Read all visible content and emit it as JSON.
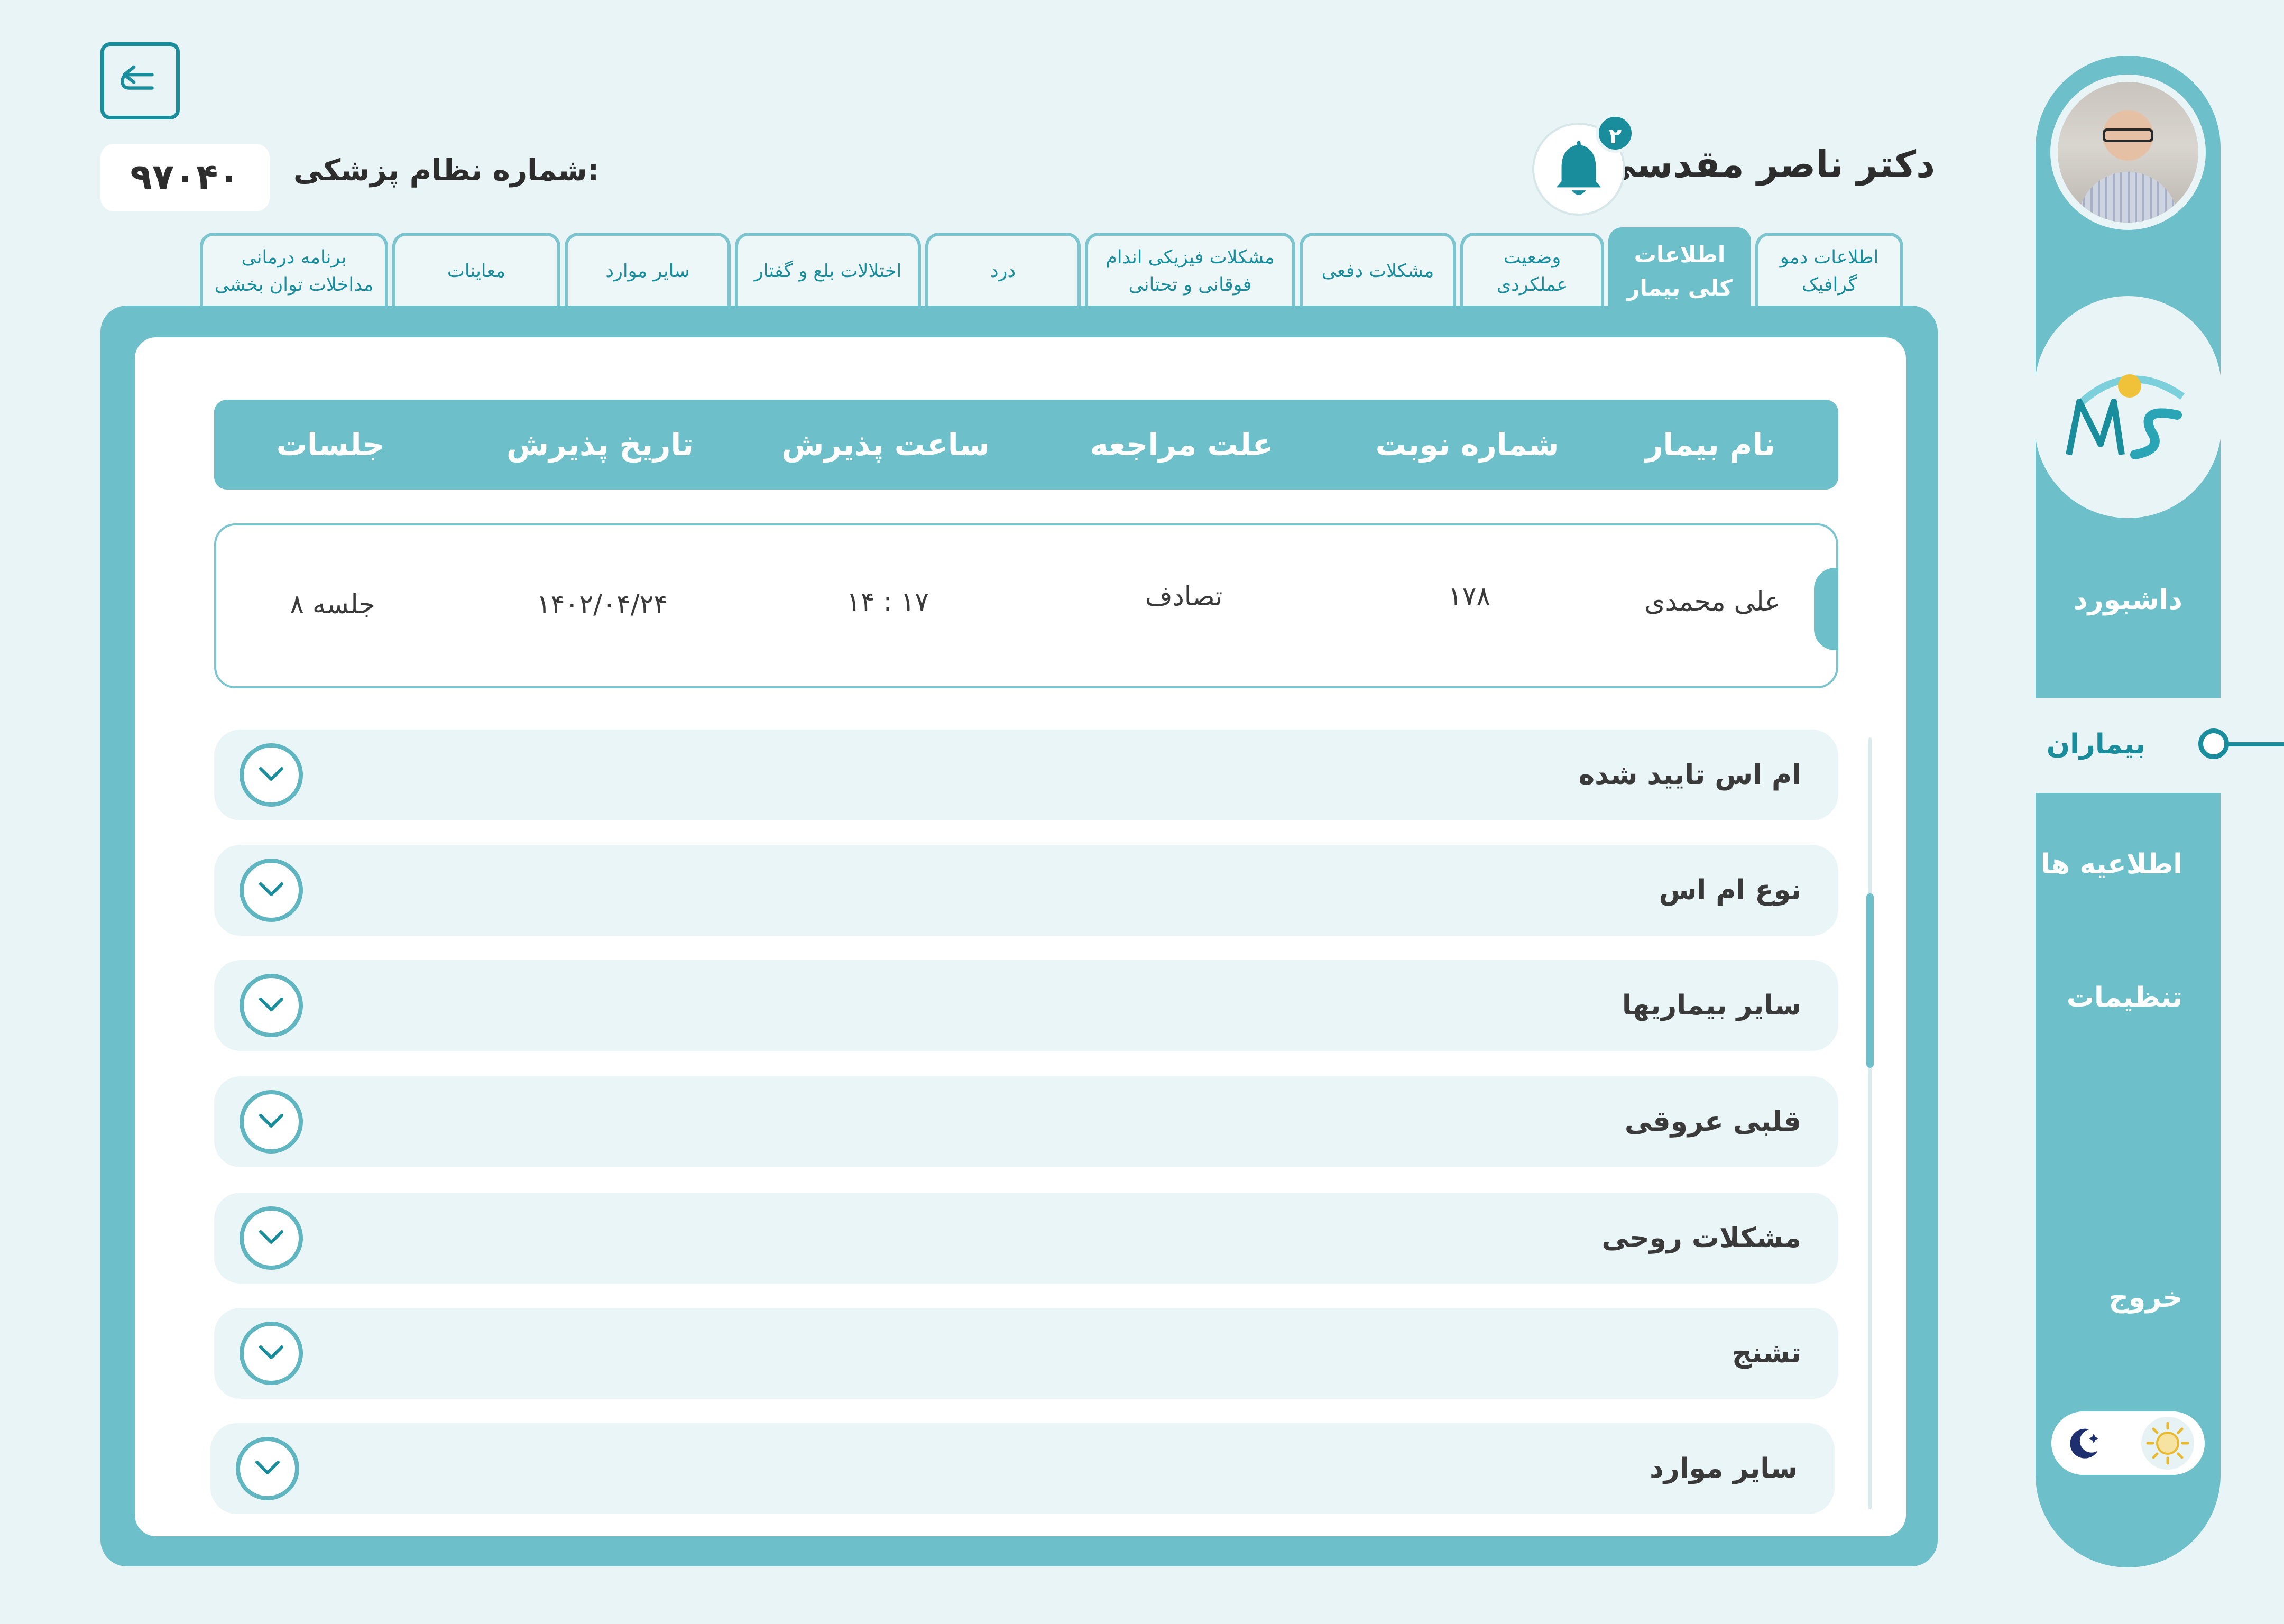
{
  "doctor": {
    "name": "دکتر ناصر مقدسی",
    "license_label": "شماره نظام پزشکی:",
    "license_number": "۹۷۰۴۰",
    "notifications": "۲"
  },
  "sidebar": {
    "items": [
      {
        "label": "داشبورد"
      },
      {
        "label": "بیماران"
      },
      {
        "label": "اطلاعیه ها"
      },
      {
        "label": "تنظیمات"
      },
      {
        "label": "خروج"
      }
    ],
    "active": "بیماران",
    "logo_text": "MS"
  },
  "tabs": [
    {
      "label": "اطلاعات دمو گرافیک"
    },
    {
      "label": "اطلاعات کلی بیمار"
    },
    {
      "label": "وضعیت عملکردی"
    },
    {
      "label": "مشکلات دفعی"
    },
    {
      "label": "مشکلات فیزیکی اندام فوقانی و تحتانی"
    },
    {
      "label": "درد"
    },
    {
      "label": "اختلالات بلع و گفتار"
    },
    {
      "label": "سایر موارد"
    },
    {
      "label": "معاینات"
    },
    {
      "label": "برنامه درمانی مداخلات توان بخشی"
    }
  ],
  "table": {
    "headers": [
      "نام بیمار",
      "شماره نوبت",
      "علت مراجعه",
      "ساعت پذیرش",
      "تاریخ پذیرش",
      "جلسات"
    ],
    "row": {
      "name": "علی محمدی",
      "turn": "۱۷۸",
      "reason": "تصادف",
      "time": "۱۴ : ۱۷",
      "date": "۱۴۰۲/۰۴/۲۴",
      "sessions": "۸ جلسه"
    }
  },
  "accordion": [
    {
      "label": "ام اس تایید شده"
    },
    {
      "label": "نوع ام اس"
    },
    {
      "label": "سایر بیماریها"
    },
    {
      "label": "قلبی عروقی"
    },
    {
      "label": "مشکلات روحی"
    },
    {
      "label": "تشنج"
    },
    {
      "label": "سایر موارد"
    }
  ],
  "colors": {
    "background": "#e9f4f6",
    "primary": "#6dbfc9",
    "accent": "#1a8d9c",
    "panel": "#ffffff"
  },
  "icons": [
    "back-arrow-icon",
    "bell-icon",
    "chevron-down-icon",
    "moon-icon",
    "sun-icon",
    "ms-logo"
  ]
}
